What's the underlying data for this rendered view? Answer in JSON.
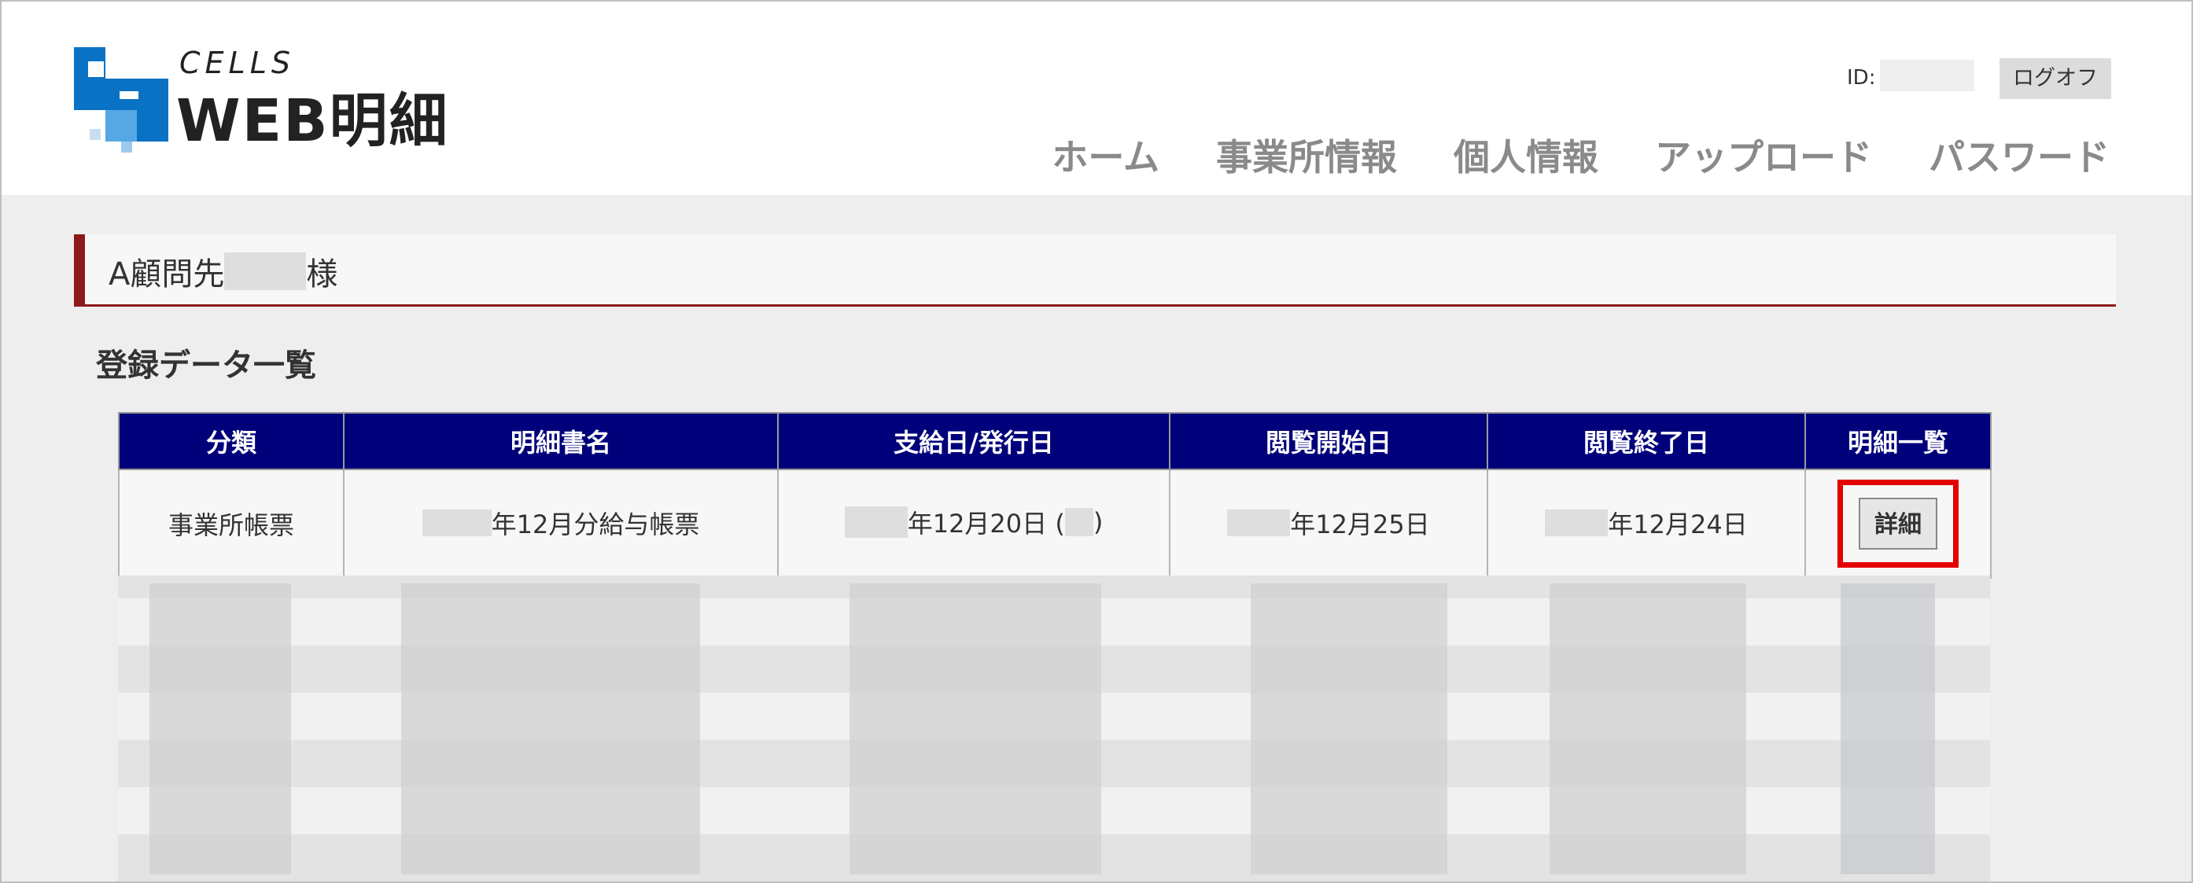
{
  "header": {
    "logo_small_text": "CELLS",
    "logo_main_text": "WEB明細",
    "id_label": "ID:",
    "logoff_label": "ログオフ",
    "nav": [
      "ホーム",
      "事業所情報",
      "個人情報",
      "アップロード",
      "パスワード"
    ]
  },
  "client": {
    "name_prefix": "A顧問先",
    "name_suffix": "様"
  },
  "section_title": "登録データ一覧",
  "table": {
    "headers": [
      "分類",
      "明細書名",
      "支給日/発行日",
      "閲覧開始日",
      "閲覧終了日",
      "明細一覧"
    ],
    "row": {
      "category": "事業所帳票",
      "doc_name": "年12月分給与帳票",
      "pay_date_part1": "年12月20日 (",
      "pay_date_part2": ")",
      "view_start": "年12月25日",
      "view_end": "年12月24日",
      "detail_label": "詳細"
    }
  },
  "colors": {
    "header_blue": "#00007b",
    "accent_red": "#8b1a1a",
    "highlight_red": "#e20000",
    "nav_gray": "#8a8a8a"
  }
}
